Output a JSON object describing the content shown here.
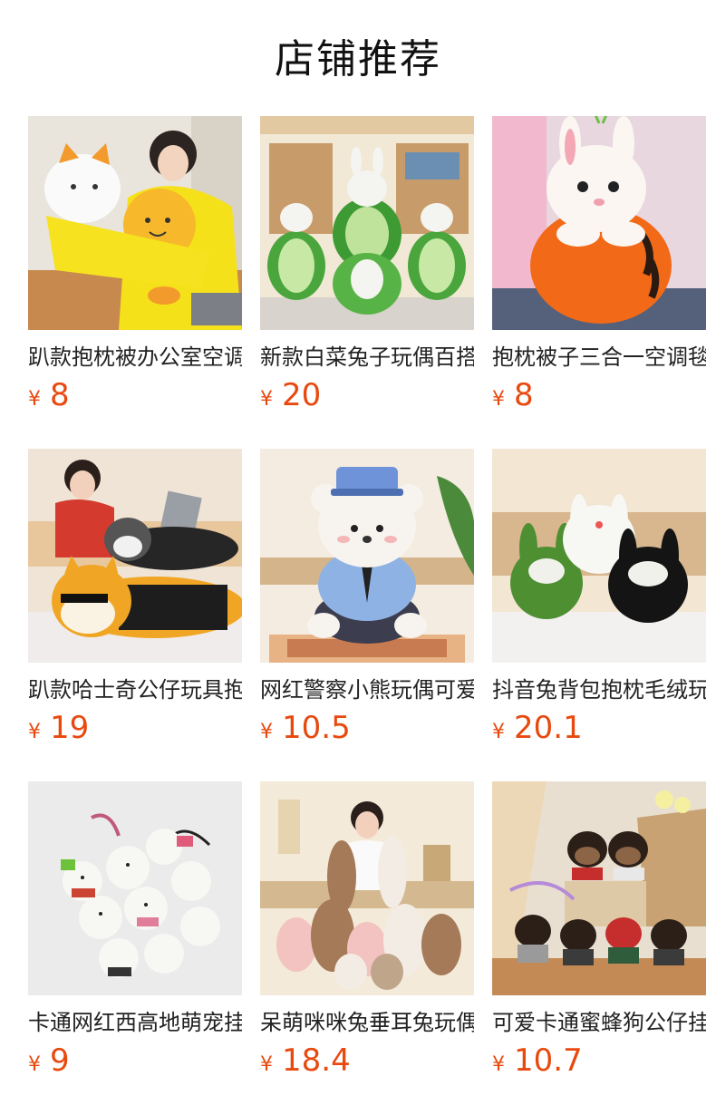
{
  "section_title": "店铺推荐",
  "currency_symbol": "¥",
  "accent_color": "#e8490f",
  "products": [
    {
      "name": "趴款抱枕被办公室空调毯",
      "price": "8",
      "thumb": "yellow-cat-plush-pillow"
    },
    {
      "name": "新款白菜兔子玩偶百搭",
      "price": "20",
      "thumb": "cabbage-bunny-plush"
    },
    {
      "name": "抱枕被子三合一空调毯",
      "price": "8",
      "thumb": "carrot-bunny-plush"
    },
    {
      "name": "趴款哈士奇公仔玩具抱枕",
      "price": "19",
      "thumb": "husky-plush-pillow"
    },
    {
      "name": "网红警察小熊玩偶可爱",
      "price": "10.5",
      "thumb": "police-bear-plush"
    },
    {
      "name": "抖音兔背包抱枕毛绒玩具",
      "price": "20.1",
      "thumb": "bunny-backpack-plush"
    },
    {
      "name": "卡通网红西高地萌宠挂件",
      "price": "9",
      "thumb": "westie-keychain-plush"
    },
    {
      "name": "呆萌咪咪兔垂耳兔玩偶",
      "price": "18.4",
      "thumb": "lop-ear-bunny-plush"
    },
    {
      "name": "可爱卡通蜜蜂狗公仔挂件",
      "price": "10.7",
      "thumb": "bee-dog-keychain-plush"
    }
  ]
}
